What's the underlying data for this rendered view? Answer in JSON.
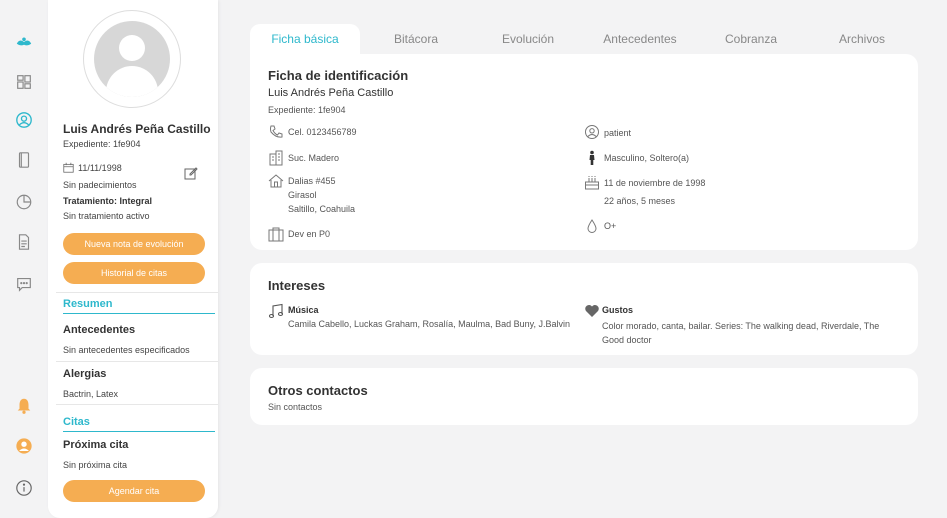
{
  "nav": {
    "icons": [
      "logo-icon",
      "dashboard-icon",
      "patients-icon",
      "agenda-icon",
      "reports-icon",
      "documents-icon",
      "messages-icon",
      "bell-icon",
      "user-icon",
      "info-icon"
    ]
  },
  "patient": {
    "name": "Luis Andrés Peña Castillo",
    "expediente": "Expediente: 1fe904",
    "dob": "11/11/1998",
    "padecimientos": "Sin padecimientos",
    "tratamiento_label": "Tratamiento: Integral",
    "tratamiento_status": "Sin tratamiento activo",
    "btn_nota": "Nueva nota de evolución",
    "btn_historial": "Historial de citas"
  },
  "resumen": {
    "title": "Resumen",
    "antecedentes_label": "Antecedentes",
    "antecedentes_value": "Sin antecedentes especificados",
    "alergias_label": "Alergias",
    "alergias_value": "Bactrin, Latex"
  },
  "citas": {
    "title": "Citas",
    "proxima_label": "Próxima cita",
    "proxima_value": "Sin próxima cita",
    "btn_agendar": "Agendar cita"
  },
  "tabs": [
    "Ficha básica",
    "Bitácora",
    "Evolución",
    "Antecedentes",
    "Cobranza",
    "Archivos"
  ],
  "ficha": {
    "title": "Ficha de identificación",
    "name": "Luis Andrés Peña Castillo",
    "expediente": "Expediente: 1fe904",
    "phone": "Cel. 0123456789",
    "sucursal": "Suc. Madero",
    "address_1": "Dalias #455",
    "address_2": "Girasol",
    "address_3": "Saltillo, Coahuila",
    "ocupacion": "Dev en P0",
    "role": "patient",
    "gender_status": "Masculino, Soltero(a)",
    "birth": "11 de noviembre de 1998",
    "age": "22 años, 5 meses",
    "blood": "O+"
  },
  "intereses": {
    "title": "Intereses",
    "musica_label": "Música",
    "musica_value": "Camila Cabello, Luckas Graham, Rosalía, Maulma, Bad Buny, J.Balvin",
    "gustos_label": "Gustos",
    "gustos_value": "Color morado, canta, bailar. Series: The walking dead, Riverdale, The Good doctor"
  },
  "contactos": {
    "title": "Otros contactos",
    "value": "Sin contactos"
  },
  "colors": {
    "accent": "#2eb8cc",
    "orange": "#f5ad52",
    "bg": "#f3f3f4"
  }
}
